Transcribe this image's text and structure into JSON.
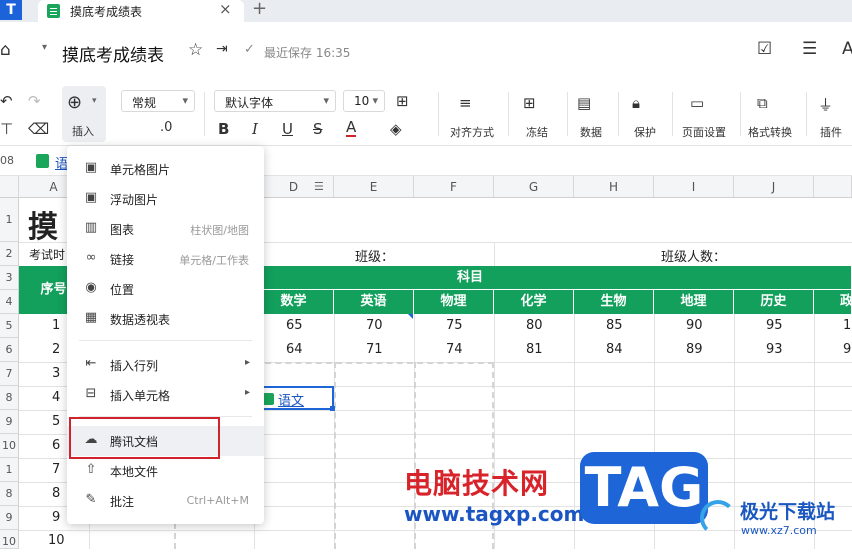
{
  "app": {
    "logo": "T"
  },
  "tab": {
    "title": "摸底考成绩表",
    "close": "×",
    "new": "+"
  },
  "doc": {
    "title": "摸底考成绩表",
    "saved": "最近保存 16:35"
  },
  "toolbar": {
    "insert": "插入",
    "num_format": "常规",
    "decimals": ".0",
    "font": "默认字体",
    "size": "10",
    "align": "对齐方式",
    "freeze": "冻结",
    "data": "数据",
    "protect": "保护",
    "page": "页面设置",
    "format": "格式转换",
    "plugin": "插件",
    "bold": "B",
    "italic": "I",
    "underline": "U",
    "strike": "S",
    "fontcolor": "A"
  },
  "formula": {
    "ref": "08",
    "chip": "语"
  },
  "columns": [
    "A",
    "D",
    "E",
    "F",
    "G",
    "H",
    "I",
    "J"
  ],
  "rows": [
    "1",
    "2",
    "3",
    "4",
    "5",
    "6",
    "7",
    "8",
    "9",
    "10",
    "1",
    "8",
    "9",
    "10"
  ],
  "sheet": {
    "title": "摸",
    "exam": "考试时",
    "class": "班级：",
    "class_count": "班级人数：",
    "subject": "科目",
    "index_head": "序号",
    "subjects": [
      "数学",
      "英语",
      "物理",
      "化学",
      "生物",
      "地理",
      "历史",
      "政"
    ],
    "row5": [
      "1",
      "65",
      "70",
      "75",
      "80",
      "85",
      "90",
      "95",
      "1"
    ],
    "row6": [
      "2",
      "64",
      "71",
      "74",
      "81",
      "84",
      "89",
      "93",
      "9"
    ],
    "idx": [
      "3",
      "4",
      "5",
      "6",
      "7",
      "8",
      "9",
      "10"
    ],
    "link": "语文"
  },
  "menu": {
    "items": [
      {
        "label": "单元格图片",
        "icon": "image-icon"
      },
      {
        "label": "浮动图片",
        "icon": "image-icon"
      },
      {
        "label": "图表",
        "hint": "柱状图/地图",
        "icon": "chart-icon"
      },
      {
        "label": "链接",
        "hint": "单元格/工作表",
        "icon": "link-icon"
      },
      {
        "label": "位置",
        "icon": "location-icon"
      },
      {
        "label": "数据透视表",
        "icon": "pivot-icon"
      },
      {
        "label": "插入行列",
        "icon": "insert-row-icon"
      },
      {
        "label": "插入单元格",
        "icon": "insert-cell-icon"
      },
      {
        "label": "腾讯文档",
        "icon": "tencent-doc-icon"
      },
      {
        "label": "本地文件",
        "icon": "upload-icon"
      },
      {
        "label": "批注",
        "hint": "Ctrl+Alt+M",
        "icon": "comment-icon"
      }
    ]
  },
  "watermark": {
    "cn": "电脑技术网",
    "url": "www.tagxp.com",
    "tag": "TAG",
    "site": "极光下载站",
    "site_url": "www.xz7.com"
  },
  "colors": {
    "accent": "#12a05c",
    "highlight": "#d0232b",
    "brand": "#1e66d8"
  }
}
